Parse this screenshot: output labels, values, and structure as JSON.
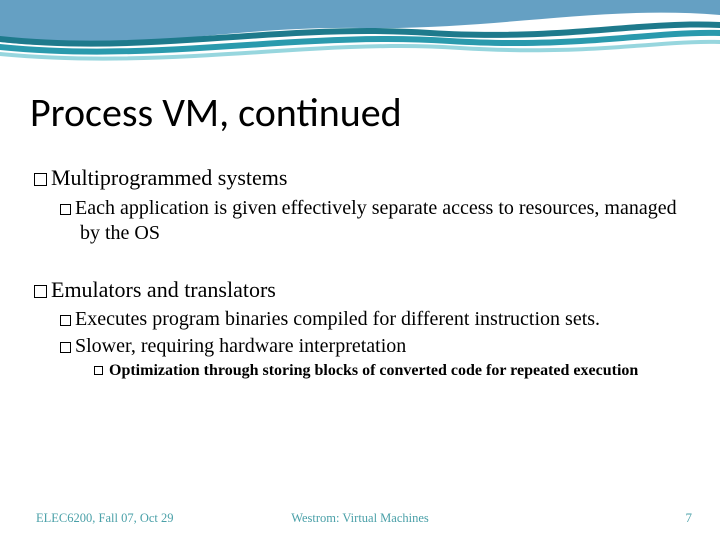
{
  "title": "Process VM, continued",
  "sections": [
    {
      "heading": "Multiprogrammed systems",
      "items": [
        {
          "text": "Each application is given effectively separate access to resources, managed by the OS",
          "sub": []
        }
      ]
    },
    {
      "heading": "Emulators and translators",
      "items": [
        {
          "text": "Executes program binaries compiled for different instruction sets.",
          "sub": []
        },
        {
          "text": "Slower, requiring hardware interpretation",
          "sub": [
            "Optimization through storing blocks of converted code for repeated execution"
          ]
        }
      ]
    }
  ],
  "footer": {
    "left": "ELEC6200, Fall 07, Oct 29",
    "center": "Westrom: Virtual Machines",
    "page": "7"
  }
}
